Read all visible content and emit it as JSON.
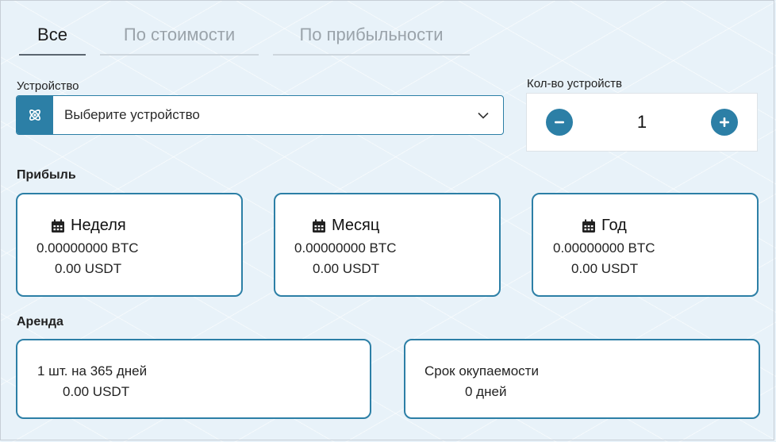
{
  "tabs": [
    {
      "label": "Все",
      "active": true
    },
    {
      "label": "По стоимости",
      "active": false
    },
    {
      "label": "По прибыльности",
      "active": false
    }
  ],
  "device": {
    "label": "Устройство",
    "placeholder": "Выберите устройство",
    "icon": "atom-icon"
  },
  "quantity": {
    "label": "Кол-во устройств",
    "value": "1"
  },
  "profit": {
    "title": "Прибыль",
    "cards": [
      {
        "period": "Неделя",
        "btc": "0.00000000 BTC",
        "usdt": "0.00 USDT"
      },
      {
        "period": "Месяц",
        "btc": "0.00000000 BTC",
        "usdt": "0.00 USDT"
      },
      {
        "period": "Год",
        "btc": "0.00000000 BTC",
        "usdt": "0.00 USDT"
      }
    ]
  },
  "rent": {
    "title": "Аренда",
    "term": "1 шт. на 365 дней",
    "price": "0.00 USDT",
    "payback_label": "Срок окупаемости",
    "payback_value": "0 дней"
  },
  "colors": {
    "accent": "#2c7fa6",
    "background": "#e8f2f9"
  }
}
